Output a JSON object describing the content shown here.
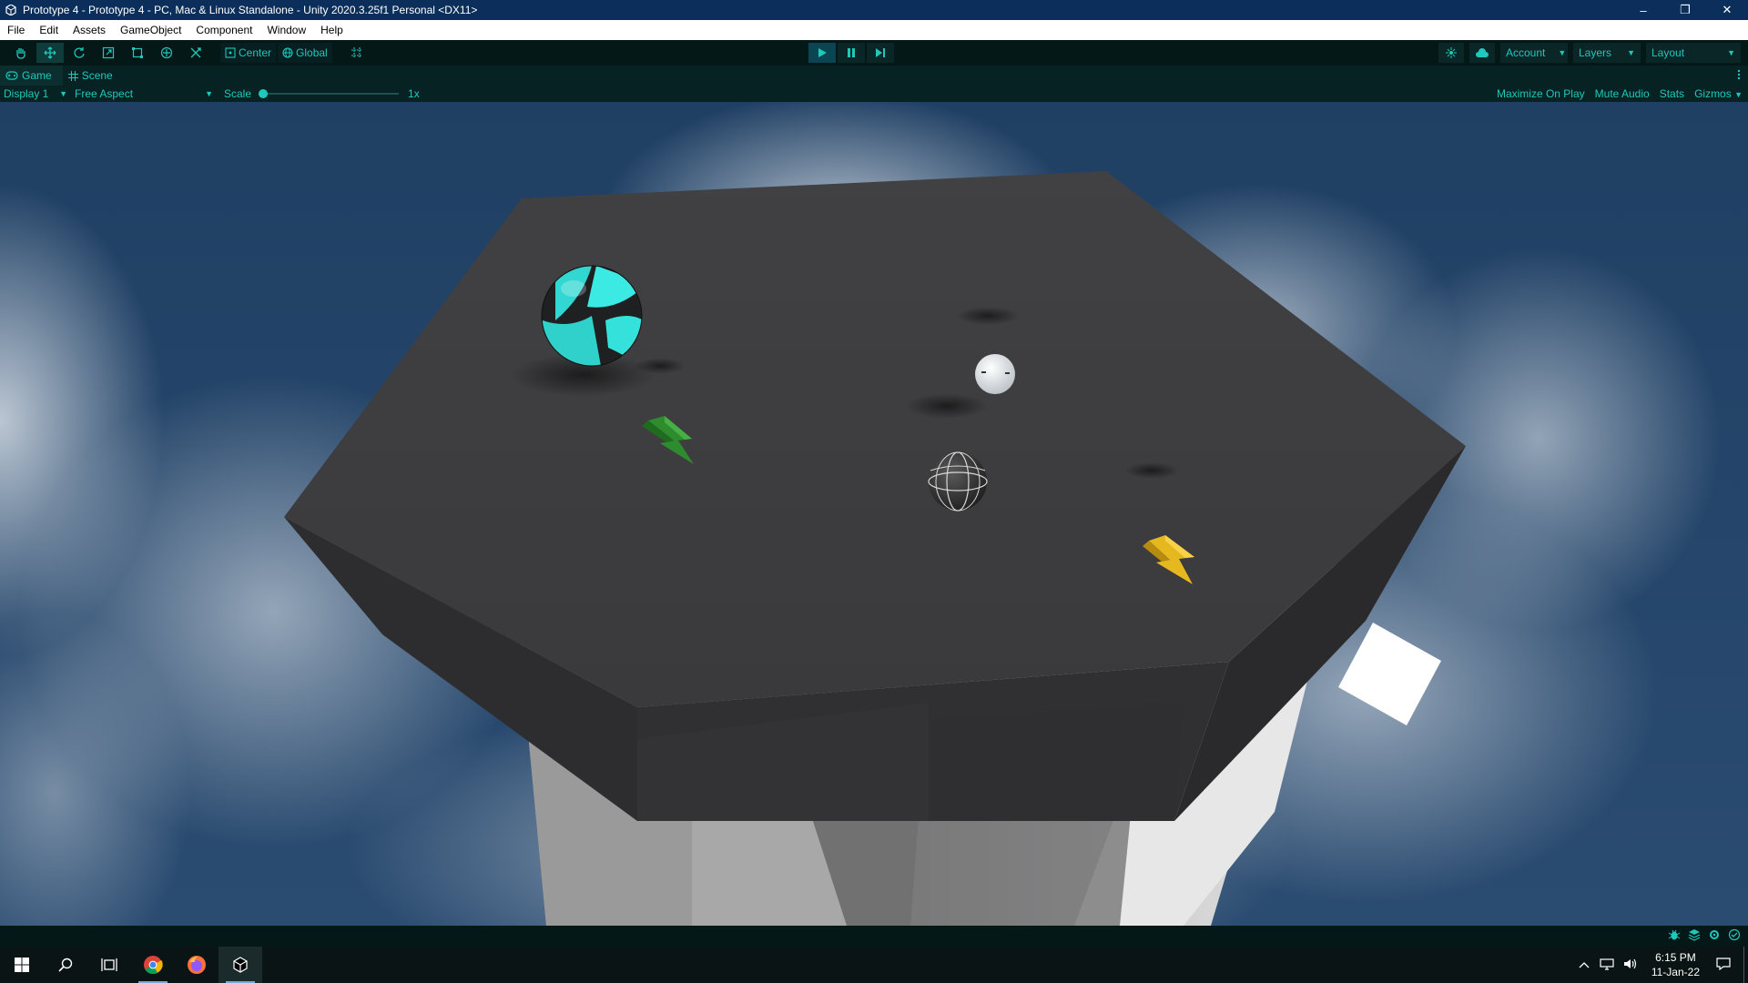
{
  "window": {
    "title": "Prototype 4 - Prototype 4 - PC, Mac & Linux Standalone - Unity 2020.3.25f1 Personal <DX11>",
    "controls": {
      "minimize": "–",
      "restore": "❐",
      "close": "✕"
    }
  },
  "menu": [
    "File",
    "Edit",
    "Assets",
    "GameObject",
    "Component",
    "Window",
    "Help"
  ],
  "toolbar": {
    "tools": [
      "hand-tool",
      "move-tool",
      "rotate-tool",
      "scale-tool",
      "rect-tool",
      "transform-tool",
      "custom-tool"
    ],
    "pivot_mode": "Center",
    "pivot_rotation": "Global",
    "account_label": "Account",
    "layers_label": "Layers",
    "layout_label": "Layout"
  },
  "tabs": [
    {
      "label": "Game",
      "icon": "gamepad-icon",
      "active": true
    },
    {
      "label": "Scene",
      "icon": "scene-grid-icon",
      "active": false
    }
  ],
  "game_toolbar": {
    "display": "Display 1",
    "aspect": "Free Aspect",
    "scale_label": "Scale",
    "scale_value": "1x",
    "scale_level": 0,
    "options": [
      "Maximize On Play",
      "Mute Audio",
      "Stats",
      "Gizmos"
    ]
  },
  "taskbar": {
    "apps": [
      "windows-start-icon",
      "search-icon",
      "task-view-icon",
      "chrome-icon",
      "firefox-icon",
      "unity-icon"
    ],
    "time": "6:15 PM",
    "date": "11-Jan-22"
  },
  "colors": {
    "accent": "#1ec9bc",
    "title_bar": "#0b2f5a",
    "toolbar_bg": "#051818",
    "platform_top": "#3d3d3f"
  }
}
